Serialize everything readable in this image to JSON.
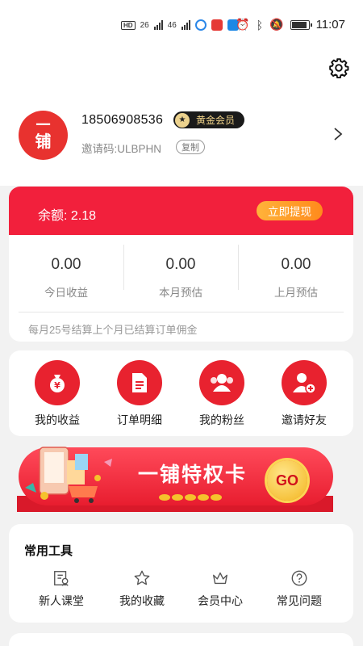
{
  "status_bar": {
    "time": "11:07",
    "signal1": "26",
    "signal2": "46"
  },
  "profile": {
    "avatar_line1": "一",
    "avatar_line2": "铺",
    "phone": "18506908536",
    "member_badge": "黄金会员",
    "invite_code": "邀请码:ULBPHN",
    "copy_label": "复制"
  },
  "balance": {
    "label": "余额: 2.18",
    "withdraw_label": "立即提现",
    "stats": [
      {
        "value": "0.00",
        "label": "今日收益"
      },
      {
        "value": "0.00",
        "label": "本月预估"
      },
      {
        "value": "0.00",
        "label": "上月预估"
      }
    ],
    "note": "每月25号结算上个月已结算订单佣金"
  },
  "quick_menu": [
    {
      "label": "我的收益",
      "icon": "money-bag-icon"
    },
    {
      "label": "订单明细",
      "icon": "document-icon"
    },
    {
      "label": "我的粉丝",
      "icon": "group-icon"
    },
    {
      "label": "邀请好友",
      "icon": "add-user-icon"
    }
  ],
  "banner": {
    "title": "一铺特权卡",
    "go_label": "GO"
  },
  "tools": {
    "title": "常用工具",
    "items": [
      {
        "label": "新人课堂",
        "icon": "classroom-icon"
      },
      {
        "label": "我的收藏",
        "icon": "star-icon"
      },
      {
        "label": "会员中心",
        "icon": "crown-icon"
      },
      {
        "label": "常见问题",
        "icon": "question-icon"
      }
    ]
  },
  "colors": {
    "primary_red": "#f2203c",
    "icon_red": "#e8222f",
    "withdraw_orange": "#ff9a28",
    "badge_gold": "#f3d58a"
  }
}
